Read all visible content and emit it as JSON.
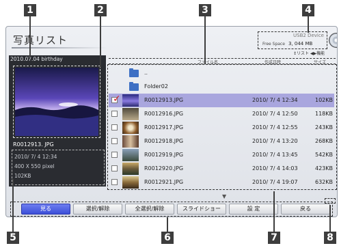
{
  "callouts": [
    "1",
    "2",
    "3",
    "4",
    "5",
    "6",
    "7",
    "8"
  ],
  "title": "写真リスト",
  "device": {
    "name": "USB2 Device",
    "free_space_label": "Free Space",
    "free_space_value": "3, 044 MB"
  },
  "sort_hint": "↕リスト ◀▶機能",
  "info_panel": {
    "folder_name": "2010.07.04 birthday",
    "file_name": "R0012913. JPG",
    "date": "2010/ 7/ 4 12:34",
    "dimensions": "400 X 550 pixel",
    "size": "102KB"
  },
  "list": {
    "headers": {
      "name": "ファイル名",
      "date": "作成日時",
      "size": "サイズ"
    },
    "parent_label": "..",
    "folder_label": "Folder02",
    "files": [
      {
        "name": "R0012913.JPG",
        "date": "2010/ 7/ 4 12:34",
        "size": "102KB",
        "checked": true,
        "selected": true
      },
      {
        "name": "R0012916.JPG",
        "date": "2010/ 7/ 4 12:50",
        "size": "118KB",
        "checked": false,
        "selected": false
      },
      {
        "name": "R0012917.JPG",
        "date": "2010/ 7/ 4 12:55",
        "size": "243KB",
        "checked": false,
        "selected": false
      },
      {
        "name": "R0012918.JPG",
        "date": "2010/ 7/ 4 13:20",
        "size": "268KB",
        "checked": false,
        "selected": false
      },
      {
        "name": "R0012919.JPG",
        "date": "2010/ 7/ 4 13:45",
        "size": "542KB",
        "checked": false,
        "selected": false
      },
      {
        "name": "R0012920.JPG",
        "date": "2010/ 7/ 4 14:03",
        "size": "423KB",
        "checked": false,
        "selected": false
      },
      {
        "name": "R0012921.JPG",
        "date": "2010/ 7/ 4 19:07",
        "size": "632KB",
        "checked": false,
        "selected": false
      }
    ]
  },
  "buttons": {
    "view": "見る",
    "select_toggle": "選択/解除",
    "select_all_toggle": "全選択/解除",
    "slideshow": "スライドショー",
    "settings": "設 定",
    "back": "戻る"
  },
  "icons": {
    "parent_folder": "folder-up-icon",
    "folder": "folder-icon",
    "device": "disc-icon",
    "scroll": "scroll-down-arrow-icon"
  },
  "colors": {
    "selected_row": "#a9a6de",
    "active_button": "#4a5ae0",
    "info_panel_bg": "#2a2c31",
    "folder_blue": "#3d6fc4",
    "check_red": "#d01f2a"
  }
}
